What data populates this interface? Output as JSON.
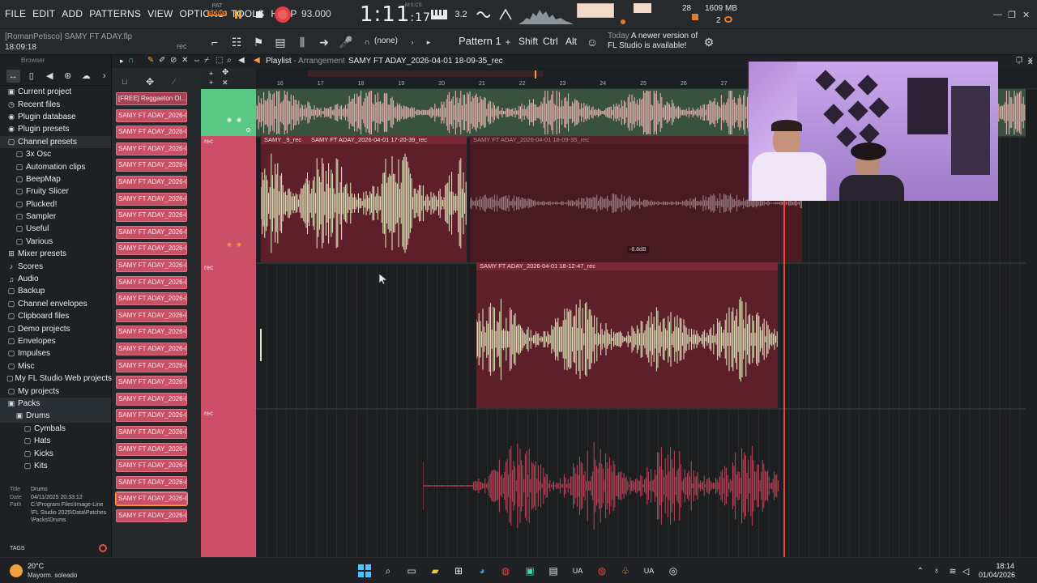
{
  "menu": [
    "FILE",
    "EDIT",
    "ADD",
    "PATTERNS",
    "VIEW",
    "OPTIONS",
    "TOOLS",
    "HELP"
  ],
  "transport": {
    "pat": "PAT",
    "song": "SONG",
    "tempo": "93.000",
    "time_main": "1:11",
    "time_sub": ":17",
    "time_unit": "M:S:CS",
    "snap": "3.2"
  },
  "monitor": {
    "cpu": "28",
    "memory": "1609 MB",
    "polyphony": "2"
  },
  "project": {
    "title": "[RomanPetisco] SAMY FT ADAY.flp",
    "time": "18:09:18",
    "rec_label": "rec"
  },
  "toolbar2": {
    "none_label": "(none)",
    "pattern": "Pattern 1",
    "shift": "Shift",
    "ctrl": "Ctrl",
    "alt": "Alt"
  },
  "news": {
    "today": "Today",
    "message": "A newer version of FL Studio is available!"
  },
  "browser": {
    "title": "Browser",
    "items": [
      {
        "label": "Current project",
        "icon": "▣",
        "indent": 0
      },
      {
        "label": "Recent files",
        "icon": "◷",
        "indent": 0
      },
      {
        "label": "Plugin database",
        "icon": "◉",
        "indent": 0
      },
      {
        "label": "Plugin presets",
        "icon": "◉",
        "indent": 0
      },
      {
        "label": "Channel presets",
        "icon": "▢",
        "indent": 0,
        "hl": true
      },
      {
        "label": "3x Osc",
        "icon": "▢",
        "indent": 1
      },
      {
        "label": "Automation clips",
        "icon": "▢",
        "indent": 1
      },
      {
        "label": "BeepMap",
        "icon": "▢",
        "indent": 1
      },
      {
        "label": "Fruity Slicer",
        "icon": "▢",
        "indent": 1
      },
      {
        "label": "Plucked!",
        "icon": "▢",
        "indent": 1
      },
      {
        "label": "Sampler",
        "icon": "▢",
        "indent": 1
      },
      {
        "label": "Useful",
        "icon": "▢",
        "indent": 1
      },
      {
        "label": "Various",
        "icon": "▢",
        "indent": 1
      },
      {
        "label": "Mixer presets",
        "icon": "⊞",
        "indent": 0
      },
      {
        "label": "Scores",
        "icon": "♪",
        "indent": 0
      },
      {
        "label": "Audio",
        "icon": "♫",
        "indent": 0
      },
      {
        "label": "Backup",
        "icon": "▢",
        "indent": 0
      },
      {
        "label": "Channel envelopes",
        "icon": "▢",
        "indent": 0
      },
      {
        "label": "Clipboard files",
        "icon": "▢",
        "indent": 0
      },
      {
        "label": "Demo projects",
        "icon": "▢",
        "indent": 0
      },
      {
        "label": "Envelopes",
        "icon": "▢",
        "indent": 0
      },
      {
        "label": "Impulses",
        "icon": "▢",
        "indent": 0
      },
      {
        "label": "Misc",
        "icon": "▢",
        "indent": 0
      },
      {
        "label": "My FL Studio Web projects",
        "icon": "▢",
        "indent": 0
      },
      {
        "label": "My projects",
        "icon": "▢",
        "indent": 0
      },
      {
        "label": "Packs",
        "icon": "▣",
        "indent": 0,
        "hl": true
      },
      {
        "label": "Drums",
        "icon": "▣",
        "indent": 1,
        "hl": true
      },
      {
        "label": "Cymbals",
        "icon": "▢",
        "indent": 2
      },
      {
        "label": "Hats",
        "icon": "▢",
        "indent": 2
      },
      {
        "label": "Kicks",
        "icon": "▢",
        "indent": 2
      },
      {
        "label": "Kits",
        "icon": "▢",
        "indent": 2
      }
    ],
    "meta": {
      "title_k": "Title",
      "title_v": "Drums",
      "date_k": "Date",
      "date_v": "04/11/2025 20:33:12",
      "path_k": "Path",
      "path_v": "C:\\Program Files\\Image-Line\\FL Studio 2025\\Data\\Patches\\Packs\\Drums"
    },
    "tags": "TAGS"
  },
  "channels": [
    "[FREE] Reggaeton Ol...",
    "SAMY FT ADAY_2026-0...",
    "SAMY FT ADAY_2026-0...",
    "SAMY FT ADAY_2026-0...",
    "SAMY FT ADAY_2026-0...",
    "SAMY FT ADAY_2026-0...",
    "SAMY FT ADAY_2026-0...",
    "SAMY FT ADAY_2026-0...",
    "SAMY FT ADAY_2026-0...",
    "SAMY FT ADAY_2026-0...",
    "SAMY FT ADAY_2026-0...",
    "SAMY FT ADAY_2026-0...",
    "SAMY FT ADAY_2026-0...",
    "SAMY FT ADAY_2026-0...",
    "SAMY FT ADAY_2026-0...",
    "SAMY FT ADAY_2026-0...",
    "SAMY FT ADAY_2026-0...",
    "SAMY FT ADAY_2026-0...",
    "SAMY FT ADAY_2026-0...",
    "SAMY FT ADAY_2026-0...",
    "SAMY FT ADAY_2026-0...",
    "SAMY FT ADAY_2026-0...",
    "SAMY FT ADAY_2026-0...",
    "SAMY FT ADAY_2026-0...",
    "SAMY FT ADAY_2026-0...",
    "SAMY FT ADAY_2026-0..."
  ],
  "playlist": {
    "title": "Playlist",
    "subtitle": "Arrangement",
    "name": "SAMY FT ADAY_2026-04-01 18-09-35_rec",
    "ruler": [
      "16",
      "17",
      "18",
      "19",
      "20",
      "21",
      "22",
      "23",
      "24",
      "25",
      "26",
      "27"
    ],
    "track_labels": [
      "rec",
      "rec",
      "rec"
    ],
    "clips": {
      "a": "SAMY _9_rec",
      "b": "SAMY FT ADAY_2026-04-01 17-20-39_rec",
      "c": "SAMY FT ADAY_2026-04-01 18-09-35_rec",
      "d": "SAMY FT ADAY_2026-04-01 18-12-47_rec"
    },
    "db_label": "-8.8dB"
  },
  "taskbar": {
    "temp": "20°C",
    "weather": "Mayorm. soleado",
    "time": "18:14",
    "date": "01/04/2026",
    "lang1": "UA",
    "lang2": "UA"
  },
  "colors": {
    "accent": "#ff9a3c",
    "clip": "#5d1f2a",
    "track": "#cc4e67",
    "playhead": "#ff4c2a"
  }
}
